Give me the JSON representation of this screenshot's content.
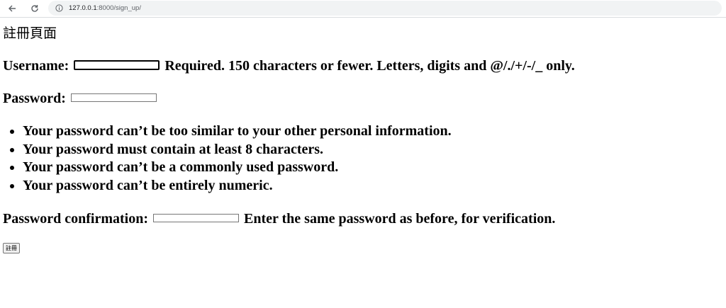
{
  "browser": {
    "url_host": "127.0.0.1",
    "url_rest": ":8000/sign_up/"
  },
  "page": {
    "title": "註冊頁面"
  },
  "form": {
    "username_label": "Username:",
    "username_help": "Required. 150 characters or fewer. Letters, digits and @/./+/-/_ only.",
    "password_label": "Password:",
    "password_help": [
      "Your password can’t be too similar to your other personal information.",
      "Your password must contain at least 8 characters.",
      "Your password can’t be a commonly used password.",
      "Your password can’t be entirely numeric."
    ],
    "confirm_label": "Password confirmation:",
    "confirm_help": "Enter the same password as before, for verification.",
    "submit_label": "註冊"
  }
}
